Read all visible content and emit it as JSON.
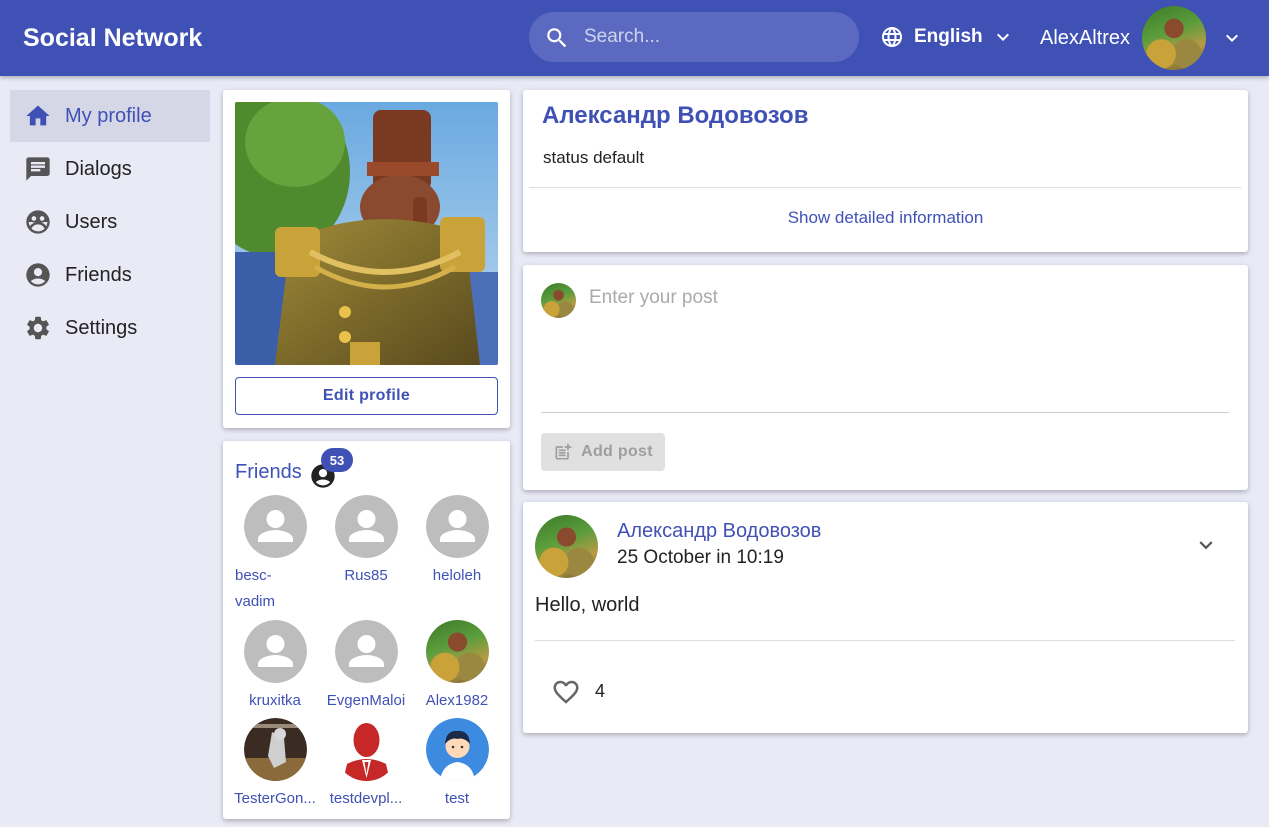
{
  "header": {
    "brand": "Social Network",
    "search_placeholder": "Search...",
    "language": "English",
    "username": "AlexAltrex"
  },
  "sidebar": {
    "items": [
      {
        "label": "My profile",
        "icon": "home-icon",
        "active": true
      },
      {
        "label": "Dialogs",
        "icon": "chat-icon",
        "active": false
      },
      {
        "label": "Users",
        "icon": "users-icon",
        "active": false
      },
      {
        "label": "Friends",
        "icon": "account-circle-icon",
        "active": false
      },
      {
        "label": "Settings",
        "icon": "gear-icon",
        "active": false
      }
    ]
  },
  "profile_photo": {
    "edit_label": "Edit profile"
  },
  "friends": {
    "title": "Friends",
    "count": "53",
    "items": [
      {
        "name": "besc-vadim",
        "display": "besc-\nvadim",
        "avatar": "default"
      },
      {
        "name": "Rus85",
        "avatar": "default"
      },
      {
        "name": "heloleh",
        "avatar": "default"
      },
      {
        "name": "kruxitka",
        "avatar": "default"
      },
      {
        "name": "EvgenMaloi",
        "avatar": "default"
      },
      {
        "name": "Alex1982",
        "avatar": "photo"
      },
      {
        "name": "TesterGon...",
        "avatar": "photo-dark"
      },
      {
        "name": "testdevpl...",
        "avatar": "red-silhouette"
      },
      {
        "name": "test",
        "avatar": "cartoon"
      }
    ]
  },
  "profile": {
    "name": "Александр Водовозов",
    "status": "status default",
    "details_link": "Show detailed information"
  },
  "post_form": {
    "placeholder": "Enter your post",
    "submit_label": "Add post"
  },
  "post": {
    "author": "Александр Водовозов",
    "date": "25 October in 10:19",
    "text": "Hello, world",
    "likes": "4"
  },
  "colors": {
    "primary": "#3f51b5",
    "background": "#e9eaf6",
    "nav_active_bg": "#d5d7e6"
  }
}
